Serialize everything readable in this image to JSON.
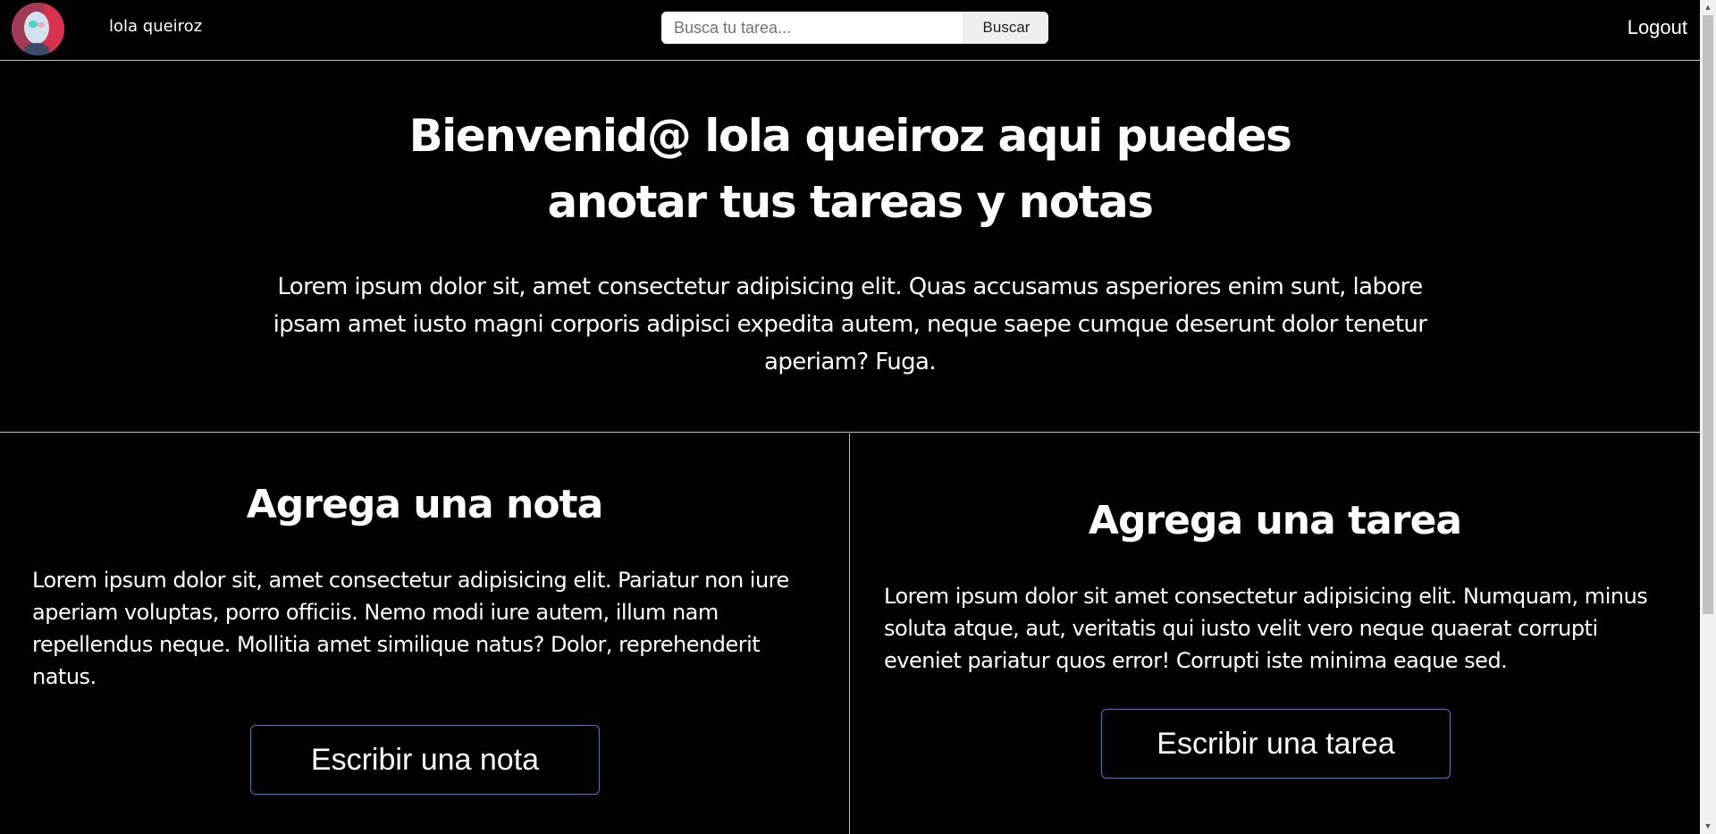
{
  "navbar": {
    "user_name": "lola queiroz",
    "search": {
      "placeholder": "Busca tu tarea...",
      "value": "",
      "button_label": "Buscar"
    },
    "logout_label": "Logout"
  },
  "hero": {
    "title": "Bienvenid@ lola queiroz aqui puedes anotar tus tareas y notas",
    "text": "Lorem ipsum dolor sit, amet consectetur adipisicing elit. Quas accusamus asperiores enim sunt, labore ipsam amet iusto magni corporis adipisci expedita autem, neque saepe cumque deserunt dolor tenetur aperiam? Fuga."
  },
  "notes_section": {
    "title": "Agrega una nota",
    "text": "Lorem ipsum dolor sit, amet consectetur adipisicing elit. Pariatur non iure aperiam voluptas, porro officiis. Nemo modi iure autem, illum nam repellendus neque. Mollitia amet similique natus? Dolor, reprehenderit natus.",
    "button_label": "Escribir una nota"
  },
  "tasks_section": {
    "title": "Agrega una tarea",
    "text": "Lorem ipsum dolor sit amet consectetur adipisicing elit. Numquam, minus soluta atque, aut, veritatis qui iusto velit vero neque quaerat corrupti eveniet pariatur quos error! Corrupti iste minima eaque sed.",
    "button_label": "Escribir una tarea"
  },
  "colors": {
    "background": "#000000",
    "text": "#ffffff",
    "divider": "#bdbdbd",
    "button_border": "#3d7bd9"
  },
  "icons": {
    "avatar": "user-avatar",
    "scroll_up": "triangle-up-icon",
    "scroll_down": "triangle-down-icon"
  }
}
